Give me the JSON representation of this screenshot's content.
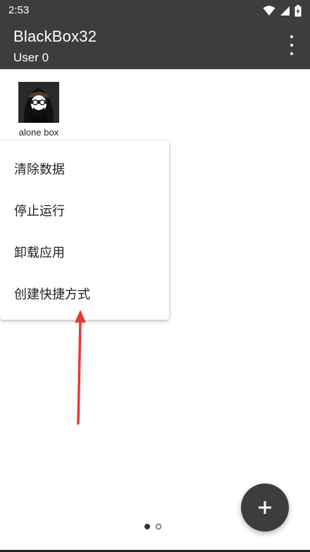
{
  "status_bar": {
    "time": "2:53",
    "icons": [
      "wifi-icon",
      "signal-icon",
      "battery-icon"
    ]
  },
  "app_bar": {
    "title": "BlackBox32",
    "subtitle": "User 0",
    "overflow_icon": "more-vert-icon"
  },
  "apps": [
    {
      "label": "alone box",
      "icon": "hooded-figure-avatar"
    }
  ],
  "context_menu": {
    "items": [
      {
        "label": "清除数据"
      },
      {
        "label": "停止运行"
      },
      {
        "label": "卸载应用"
      },
      {
        "label": "创建快捷方式"
      }
    ]
  },
  "annotation": {
    "arrow_color": "#e53935"
  },
  "pager": {
    "pages": 2,
    "current": 1
  },
  "fab": {
    "icon": "plus-icon"
  },
  "colors": {
    "bar": "#3d3d3d",
    "background": "#ffffff",
    "accent": "#e53935"
  }
}
